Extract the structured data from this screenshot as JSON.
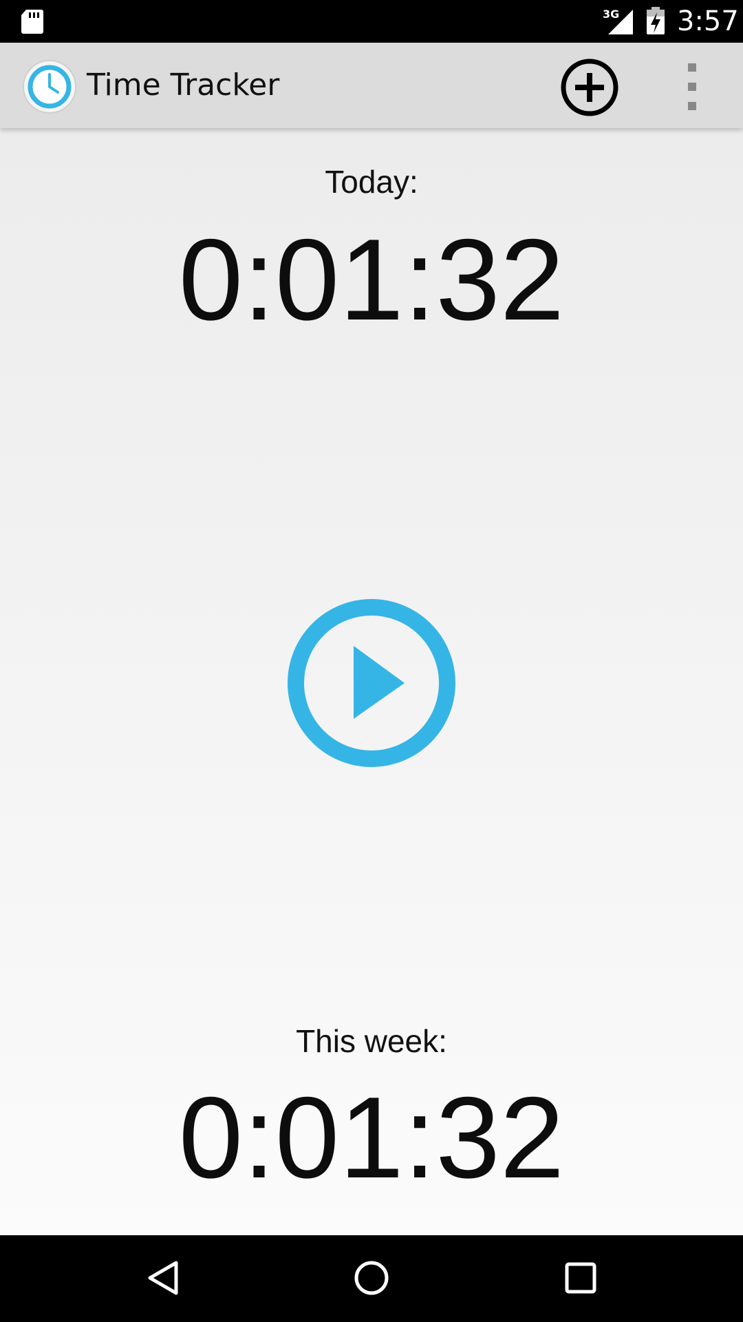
{
  "status_bar": {
    "time": "3:57",
    "network": "3G",
    "icons": [
      "sd-card-icon",
      "signal-icon",
      "battery-charging-icon"
    ]
  },
  "action_bar": {
    "title": "Time Tracker",
    "app_icon": "clock-icon",
    "add_icon": "add-circle-icon",
    "overflow_icon": "overflow-menu-icon"
  },
  "main": {
    "today_label": "Today:",
    "today_time": "0:01:32",
    "play_icon": "play-icon",
    "week_label": "This week:",
    "week_time": "0:01:32"
  },
  "nav_bar": {
    "icons": [
      "back-icon",
      "home-icon",
      "recents-icon"
    ]
  },
  "colors": {
    "accent": "#35b5e5",
    "action_bar_bg": "#dcdcdc",
    "status_bar_bg": "#000000"
  }
}
